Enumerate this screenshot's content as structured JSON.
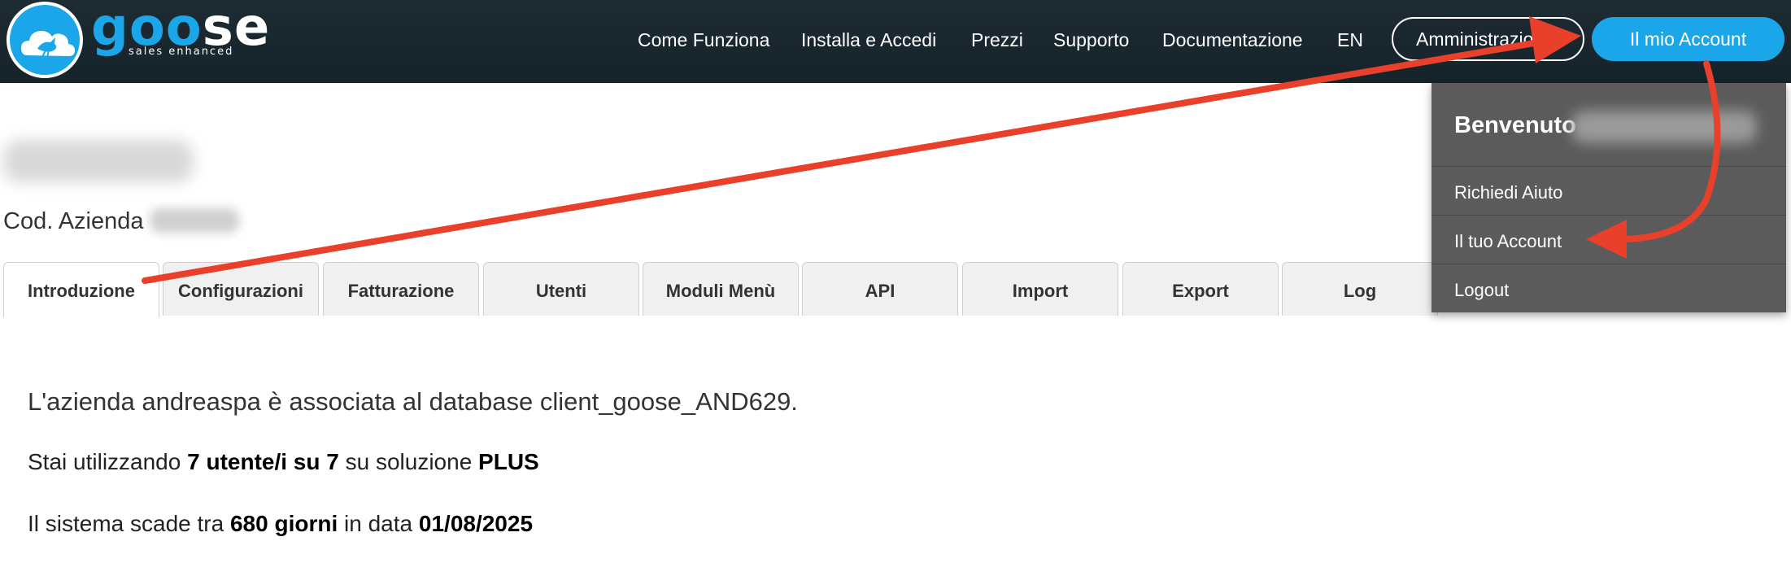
{
  "brand": {
    "word_part1": "goo",
    "word_part2": "se",
    "tagline": "sales enhanced",
    "colors": {
      "header_bg": "#1e2b33",
      "accent": "#1aa6e8",
      "dropdown_bg": "#5b5b5b",
      "arrow": "#e8402a"
    }
  },
  "nav": {
    "items": [
      "Come Funziona",
      "Installa e Accedi",
      "Prezzi",
      "Supporto",
      "Documentazione",
      "EN"
    ],
    "admin_label": "Amministrazione",
    "account_label": "Il mio Account"
  },
  "company": {
    "cod_label": "Cod. Azienda"
  },
  "tabs": [
    "Introduzione",
    "Configurazioni",
    "Fatturazione",
    "Utenti",
    "Moduli Menù",
    "API",
    "Import",
    "Export",
    "Log"
  ],
  "active_tab": "Introduzione",
  "content": {
    "line1": "L'azienda andreaspa è associata al database client_goose_AND629.",
    "line2_pre": "Stai utilizzando ",
    "line2_users": "7 utente/i su 7",
    "line2_mid": " su soluzione ",
    "line2_plan": "PLUS",
    "line3_pre": "Il sistema scade tra ",
    "line3_days": "680 giorni",
    "line3_mid": " in data ",
    "line3_date": "01/08/2025"
  },
  "dropdown": {
    "welcome": "Benvenuto",
    "items": [
      "Richiedi Aiuto",
      "Il tuo Account",
      "Logout"
    ]
  }
}
